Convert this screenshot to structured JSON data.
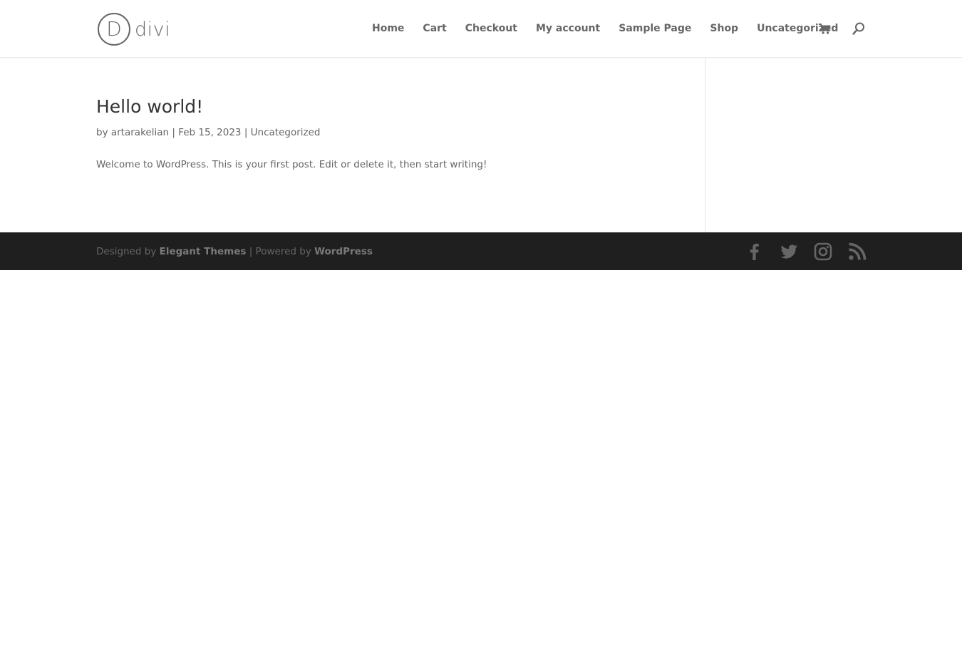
{
  "header": {
    "logo": {
      "mark": "D",
      "text": "divi"
    },
    "nav": [
      {
        "label": "Home"
      },
      {
        "label": "Cart"
      },
      {
        "label": "Checkout"
      },
      {
        "label": "My account"
      },
      {
        "label": "Sample Page"
      },
      {
        "label": "Shop"
      },
      {
        "label": "Uncategorized"
      }
    ],
    "icons": {
      "cart": "cart-icon",
      "search": "search-icon"
    }
  },
  "post": {
    "title": "Hello world!",
    "meta": {
      "by": "by",
      "author": "artarakelian",
      "sep1": "|",
      "date": "Feb 15, 2023",
      "sep2": "|",
      "category": "Uncategorized"
    },
    "excerpt": "Welcome to WordPress. This is your first post. Edit or delete it, then start writing!"
  },
  "footer": {
    "designed_by": "Designed by",
    "theme_link": "Elegant Themes",
    "powered_by": "| Powered by",
    "wp_link": "WordPress",
    "social": [
      "facebook-icon",
      "twitter-icon",
      "instagram-icon",
      "rss-icon"
    ]
  },
  "colors": {
    "text": "#666666",
    "title": "#333333",
    "footer_bg": "#1f1f1f",
    "footer_icon": "#666666",
    "divider": "#e2e2e2"
  }
}
